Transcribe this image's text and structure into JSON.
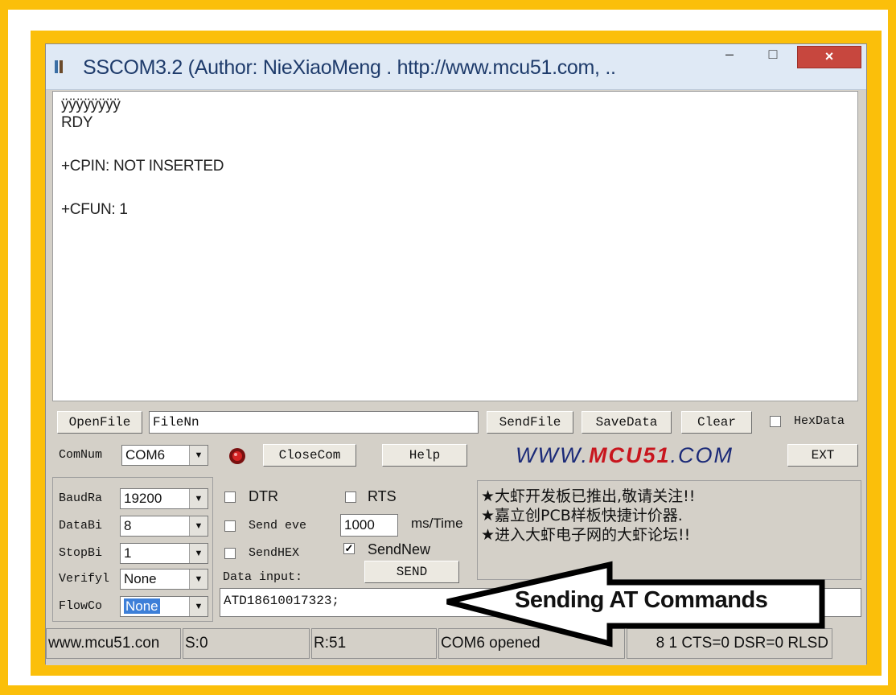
{
  "window": {
    "title": "SSCOM3.2 (Author: NieXiaoMeng . http://www.mcu51.com, ..",
    "minimize": "–",
    "maximize": "□",
    "close": "×"
  },
  "output": {
    "lines": [
      "ÿÿÿÿÿÿÿÿ",
      "RDY",
      "+CPIN: NOT INSERTED",
      "+CFUN: 1"
    ]
  },
  "toolbar": {
    "open_file": "OpenFile",
    "file_name": "FileNn",
    "send_file": "SendFile",
    "save_data": "SaveData",
    "clear": "Clear",
    "hex_data": "HexData"
  },
  "port": {
    "com_label": "ComNum",
    "com_value": "COM6",
    "close_com": "CloseCom",
    "help": "Help",
    "brand_a": "WWW.",
    "brand_b": "MCU51",
    "brand_c": ".COM",
    "ext": "EXT"
  },
  "settings": {
    "baud_label": "BaudRa",
    "baud_value": "19200",
    "data_label": "DataBi",
    "data_value": "8",
    "stop_label": "StopBi",
    "stop_value": "1",
    "verify_label": "Verifyl",
    "verify_value": "None",
    "flow_label": "FlowCo",
    "flow_value": "None"
  },
  "options": {
    "dtr": "DTR",
    "rts": "RTS",
    "send_every": "Send eve",
    "interval": "1000",
    "interval_unit": "ms/Time",
    "send_hex": "SendHEX",
    "send_new": "SendNew",
    "data_input": "Data input:",
    "send": "SEND",
    "command": "ATD18610017323;"
  },
  "notice": {
    "lines": [
      "★大虾开发板已推出,敬请关注!!",
      "★嘉立创PCB样板快捷计价器.",
      "★进入大虾电子网的大虾论坛!!"
    ]
  },
  "status": {
    "site": "www.mcu51.con",
    "sent": "S:0",
    "received": "R:51",
    "port_status": "COM6 opened",
    "params": "8 1 CTS=0 DSR=0 RLSD"
  },
  "annotation": {
    "text": "Sending AT Commands"
  },
  "colors": {
    "frame": "#fbbf0a",
    "brand_blue": "#1b2a78",
    "brand_red": "#c8161e",
    "close_button": "#c7473e"
  }
}
